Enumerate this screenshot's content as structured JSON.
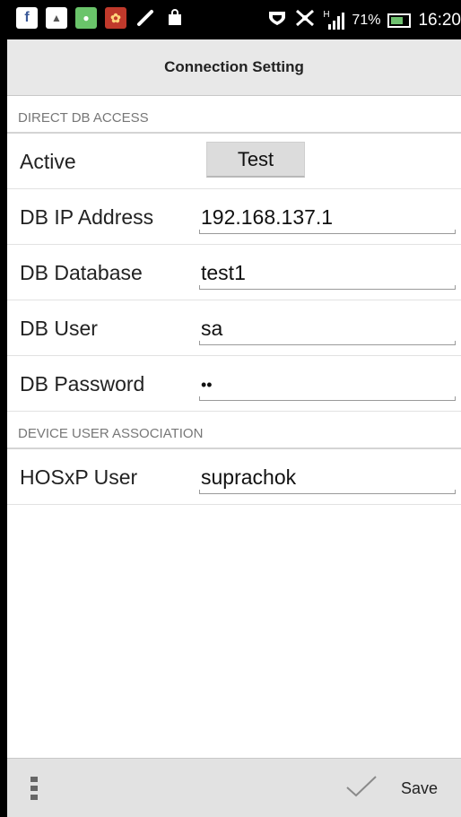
{
  "status_bar": {
    "left_icons": [
      {
        "name": "facebook-icon",
        "glyph": "f",
        "bg": "#ffffff"
      },
      {
        "name": "gallery-icon",
        "glyph": "▲",
        "bg": "#ffffff"
      },
      {
        "name": "line-app-icon",
        "glyph": "●",
        "bg": "#6ac46a"
      },
      {
        "name": "game-app-icon",
        "glyph": "✿",
        "bg": "#c0392b"
      },
      {
        "name": "pen-icon",
        "glyph": "⟋",
        "bg": "#000000"
      },
      {
        "name": "store-bag-icon",
        "glyph": "⬚",
        "bg": "#ffffff"
      }
    ],
    "battery_percent": "71%",
    "time": "16:20",
    "signal_label": "H"
  },
  "header": {
    "title": "Connection Setting"
  },
  "sections": {
    "direct_db": {
      "title": "DIRECT DB ACCESS"
    },
    "device_user": {
      "title": "DEVICE USER ASSOCIATION"
    }
  },
  "rows": {
    "active": {
      "label": "Active",
      "button": "Test"
    },
    "ip": {
      "label": "DB IP Address",
      "value": "192.168.137.1"
    },
    "database": {
      "label": "DB Database",
      "value": "test1"
    },
    "user": {
      "label": "DB User",
      "value": "sa"
    },
    "password": {
      "label": "DB Password",
      "value": "••"
    },
    "hosxp": {
      "label": "HOSxP User",
      "value": "suprachok"
    }
  },
  "bottom_bar": {
    "save_label": "Save"
  }
}
